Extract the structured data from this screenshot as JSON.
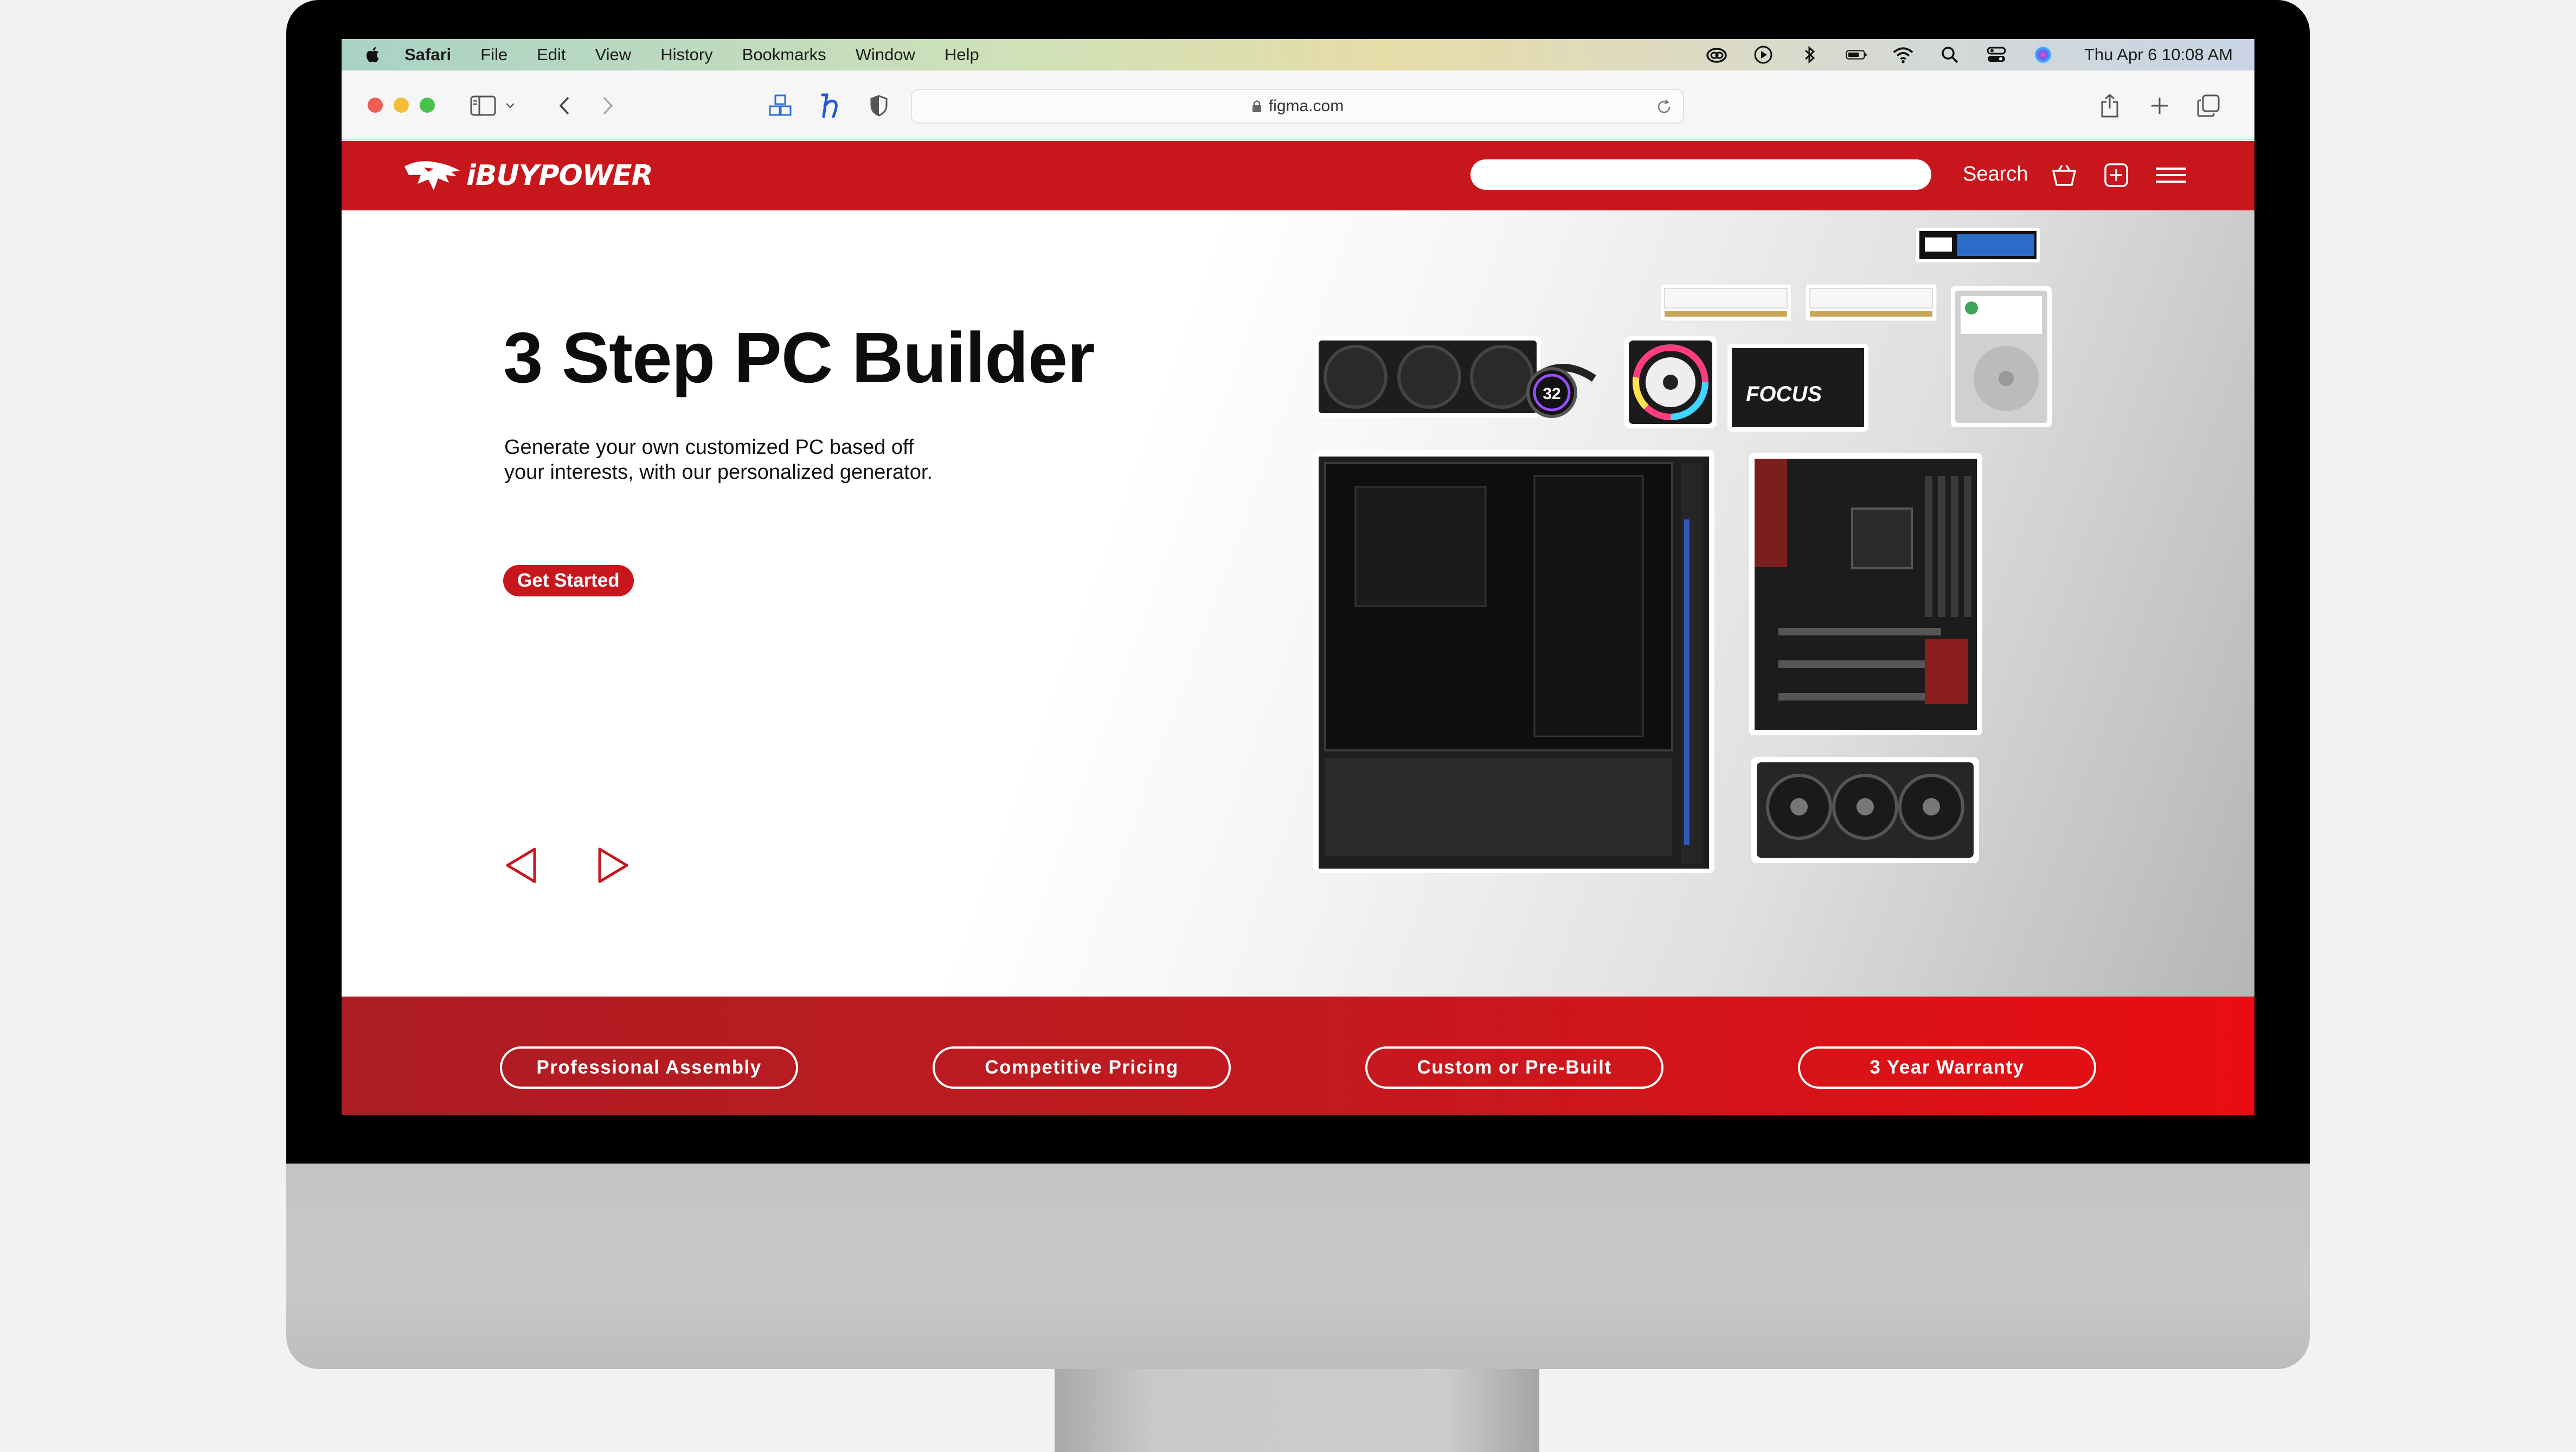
{
  "menubar": {
    "app_name": "Safari",
    "items": [
      "File",
      "Edit",
      "View",
      "History",
      "Bookmarks",
      "Window",
      "Help"
    ],
    "clock": "Thu Apr 6  10:08 AM",
    "status_icons": [
      "creative-cloud-icon",
      "play-icon",
      "bluetooth-icon",
      "battery-icon",
      "wifi-icon",
      "spotlight-icon",
      "control-center-icon",
      "siri-icon"
    ]
  },
  "browser": {
    "url": "figma.com"
  },
  "site": {
    "brand": "iBUYPOWER",
    "search_label": "Search",
    "search_placeholder": "",
    "accent_color": "#c8161d"
  },
  "hero": {
    "title": "3 Step PC Builder",
    "subtitle_line1": "Generate your own customized PC based off",
    "subtitle_line2": "your interests, with our personalized generator.",
    "cta_label": "Get Started",
    "aio_display": "32",
    "psu_label": "FOCUS"
  },
  "features": [
    "Professional Assembly",
    "Competitive Pricing",
    "Custom or Pre-Built",
    "3 Year Warranty"
  ]
}
